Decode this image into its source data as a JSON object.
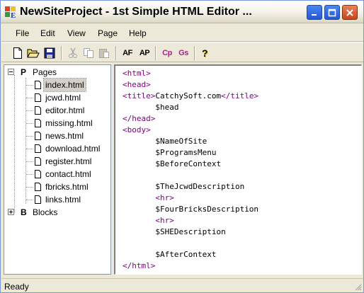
{
  "window": {
    "title": "NewSiteProject - 1st Simple HTML Editor ...",
    "icon": "app-logo-icon"
  },
  "menu": {
    "items": [
      "File",
      "Edit",
      "View",
      "Page",
      "Help"
    ]
  },
  "toolbar": {
    "buttons": [
      {
        "name": "new-file-icon"
      },
      {
        "name": "open-folder-icon"
      },
      {
        "name": "save-icon"
      },
      {
        "name": "cut-icon"
      },
      {
        "name": "copy-icon"
      },
      {
        "name": "paste-icon"
      },
      {
        "name": "add-file-button",
        "label": "AF"
      },
      {
        "name": "add-page-button",
        "label": "AP"
      },
      {
        "name": "copy-page-button",
        "label": "Cp"
      },
      {
        "name": "generate-site-button",
        "label": "Gs"
      },
      {
        "name": "help-icon",
        "label": "?"
      }
    ]
  },
  "tree": {
    "pages": {
      "letter": "P",
      "label": "Pages",
      "files": [
        "index.html",
        "jcwd.html",
        "editor.html",
        "missing.html",
        "news.html",
        "download.html",
        "register.html",
        "contact.html",
        "fbricks.html",
        "links.html"
      ],
      "selected": "index.html"
    },
    "blocks": {
      "letter": "B",
      "label": "Blocks"
    }
  },
  "editor": {
    "lines": [
      {
        "indent": "",
        "parts": [
          {
            "t": "tag",
            "v": "<html>"
          }
        ]
      },
      {
        "indent": "",
        "parts": [
          {
            "t": "tag",
            "v": "<head>"
          }
        ]
      },
      {
        "indent": "",
        "parts": [
          {
            "t": "tag",
            "v": "<title>"
          },
          {
            "t": "txt",
            "v": "CatchySoft.com"
          },
          {
            "t": "tag",
            "v": "</title>"
          }
        ]
      },
      {
        "indent": "       ",
        "parts": [
          {
            "t": "txt",
            "v": "$head"
          }
        ]
      },
      {
        "indent": "",
        "parts": [
          {
            "t": "tag",
            "v": "</head>"
          }
        ]
      },
      {
        "indent": "",
        "parts": [
          {
            "t": "tag",
            "v": "<body>"
          }
        ]
      },
      {
        "indent": "       ",
        "parts": [
          {
            "t": "txt",
            "v": "$NameOfSite"
          }
        ]
      },
      {
        "indent": "       ",
        "parts": [
          {
            "t": "txt",
            "v": "$ProgramsMenu"
          }
        ]
      },
      {
        "indent": "       ",
        "parts": [
          {
            "t": "txt",
            "v": "$BeforeContext"
          }
        ]
      },
      {
        "indent": "",
        "parts": []
      },
      {
        "indent": "       ",
        "parts": [
          {
            "t": "txt",
            "v": "$TheJcwdDescription"
          }
        ]
      },
      {
        "indent": "       ",
        "parts": [
          {
            "t": "tag",
            "v": "<hr>"
          }
        ]
      },
      {
        "indent": "       ",
        "parts": [
          {
            "t": "txt",
            "v": "$FourBricksDescription"
          }
        ]
      },
      {
        "indent": "       ",
        "parts": [
          {
            "t": "tag",
            "v": "<hr>"
          }
        ]
      },
      {
        "indent": "       ",
        "parts": [
          {
            "t": "txt",
            "v": "$SHEDescription"
          }
        ]
      },
      {
        "indent": "",
        "parts": []
      },
      {
        "indent": "       ",
        "parts": [
          {
            "t": "txt",
            "v": "$AfterContext"
          }
        ]
      },
      {
        "indent": "",
        "parts": [
          {
            "t": "tag",
            "v": "</html>"
          }
        ]
      }
    ]
  },
  "status": {
    "text": "Ready"
  },
  "colors": {
    "tag": "#800080",
    "text": "#000000",
    "chrome": "#ece9d8",
    "title_button_blue": "#2457d8",
    "close_button_red": "#c7451c"
  }
}
